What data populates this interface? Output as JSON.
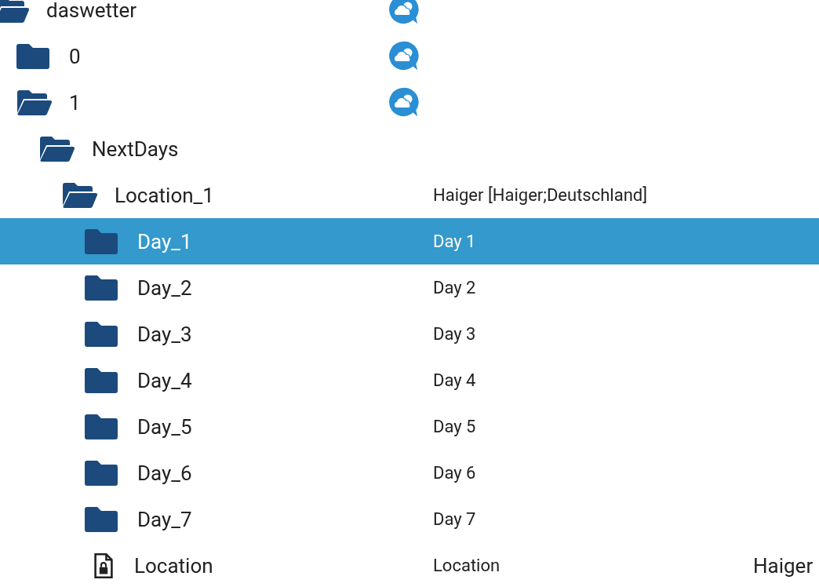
{
  "tree": [
    {
      "name": "daswetter",
      "kind": "folder",
      "expanded": true,
      "selected": false,
      "logo": true,
      "children": [
        {
          "name": "0",
          "kind": "folder",
          "expanded": false,
          "selected": false,
          "logo": true
        },
        {
          "name": "1",
          "kind": "folder",
          "expanded": true,
          "selected": false,
          "logo": true,
          "children": [
            {
              "name": "NextDays",
              "kind": "folder",
              "expanded": true,
              "selected": false,
              "children": [
                {
                  "name": "Location_1",
                  "kind": "folder",
                  "expanded": true,
                  "selected": false,
                  "title": "Haiger [Haiger;Deutschland]",
                  "children": [
                    {
                      "name": "Day_1",
                      "kind": "folder",
                      "expanded": false,
                      "selected": true,
                      "title": "Day 1"
                    },
                    {
                      "name": "Day_2",
                      "kind": "folder",
                      "expanded": false,
                      "selected": false,
                      "title": "Day 2"
                    },
                    {
                      "name": "Day_3",
                      "kind": "folder",
                      "expanded": false,
                      "selected": false,
                      "title": "Day 3"
                    },
                    {
                      "name": "Day_4",
                      "kind": "folder",
                      "expanded": false,
                      "selected": false,
                      "title": "Day 4"
                    },
                    {
                      "name": "Day_5",
                      "kind": "folder",
                      "expanded": false,
                      "selected": false,
                      "title": "Day 5"
                    },
                    {
                      "name": "Day_6",
                      "kind": "folder",
                      "expanded": false,
                      "selected": false,
                      "title": "Day 6"
                    },
                    {
                      "name": "Day_7",
                      "kind": "folder",
                      "expanded": false,
                      "selected": false,
                      "title": "Day 7"
                    },
                    {
                      "name": "Location",
                      "kind": "state",
                      "selected": false,
                      "title": "Location",
                      "value": "Haiger"
                    }
                  ]
                }
              ]
            }
          ]
        }
      ]
    }
  ]
}
